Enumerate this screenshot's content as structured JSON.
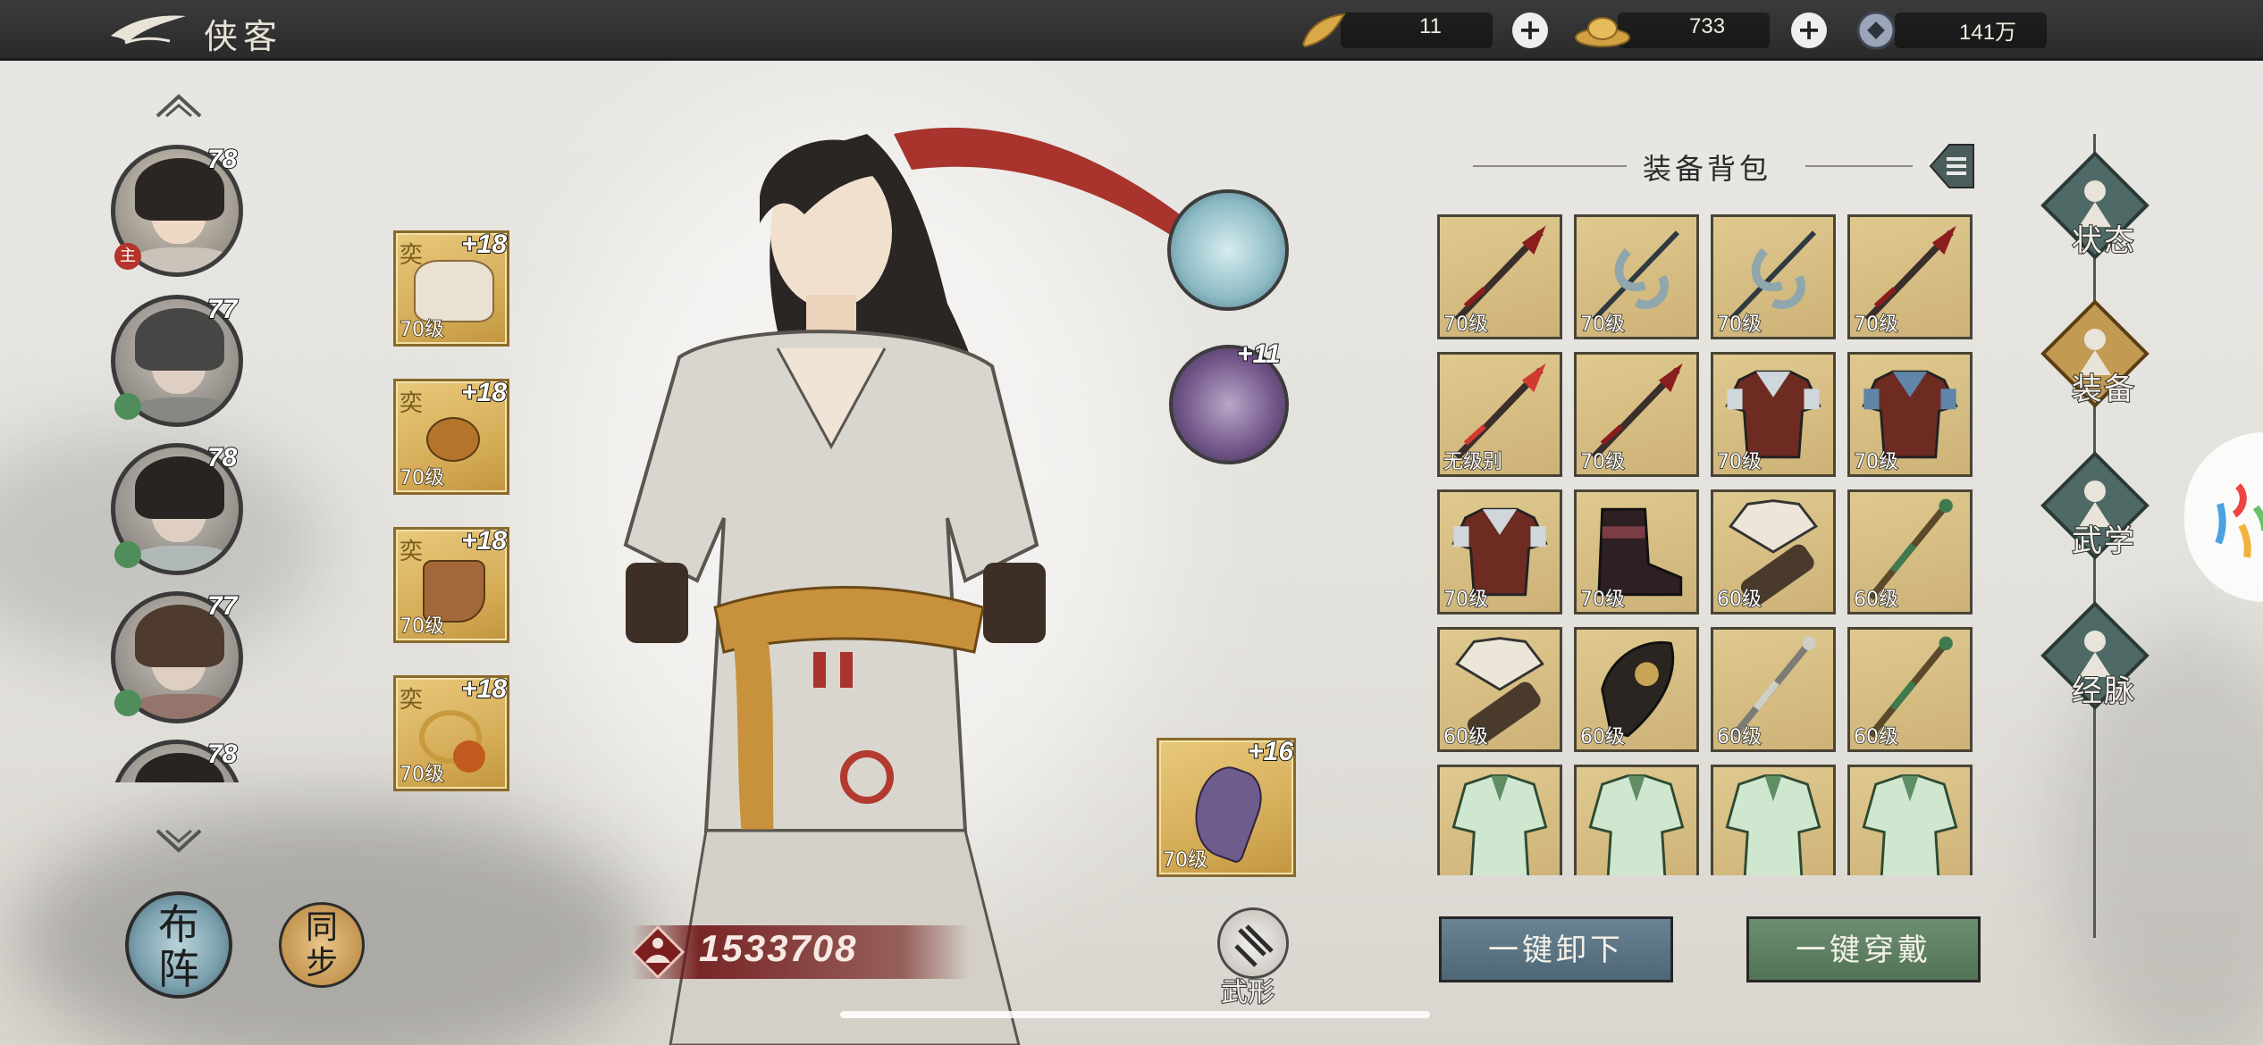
{
  "header": {
    "title": "侠客",
    "resources": [
      {
        "icon": "gold-ingot-icon",
        "value": "11"
      },
      {
        "icon": "gold-yuanbao-icon",
        "value": "733"
      },
      {
        "icon": "copper-coin-icon",
        "value": "141万"
      }
    ]
  },
  "roster": [
    {
      "level": "78",
      "badge": "主",
      "selected": true
    },
    {
      "level": "77",
      "badge": "",
      "selected": false
    },
    {
      "level": "78",
      "badge": "",
      "selected": false
    },
    {
      "level": "77",
      "badge": "",
      "selected": false
    },
    {
      "level": "78",
      "badge": "",
      "selected": false
    }
  ],
  "left_buttons": {
    "formation": "布阵",
    "sync": "同步"
  },
  "equipped": [
    {
      "plus": "+18",
      "level": "70级",
      "sigil": "奕",
      "kind": "robe"
    },
    {
      "plus": "+18",
      "level": "70级",
      "sigil": "奕",
      "kind": "belt"
    },
    {
      "plus": "+18",
      "level": "70级",
      "sigil": "奕",
      "kind": "boots"
    },
    {
      "plus": "+18",
      "level": "70级",
      "sigil": "奕",
      "kind": "ring"
    }
  ],
  "skill_orbs": [
    {
      "plus": "",
      "icon": "cloud-orb-icon"
    },
    {
      "plus": "+11",
      "icon": "purple-orb-icon"
    }
  ],
  "weapon_slot": {
    "plus": "+16",
    "level": "70级"
  },
  "power": {
    "value": "1533708"
  },
  "wuxing": {
    "label": "武形"
  },
  "bag": {
    "title": "装备背包",
    "items": [
      {
        "kind": "spear",
        "level": "70级"
      },
      {
        "kind": "claw",
        "level": "70级"
      },
      {
        "kind": "claw",
        "level": "70级"
      },
      {
        "kind": "spear",
        "level": "70级"
      },
      {
        "kind": "blade-red",
        "level": "无级别"
      },
      {
        "kind": "spear",
        "level": "70级"
      },
      {
        "kind": "armor",
        "level": "70级"
      },
      {
        "kind": "armor-blue",
        "level": "70级"
      },
      {
        "kind": "armor",
        "level": "70级"
      },
      {
        "kind": "boots",
        "level": "70级"
      },
      {
        "kind": "fan",
        "level": "60级"
      },
      {
        "kind": "staff",
        "level": "60级"
      },
      {
        "kind": "fan",
        "level": "60级"
      },
      {
        "kind": "shield",
        "level": "60级"
      },
      {
        "kind": "staff-silver",
        "level": "60级"
      },
      {
        "kind": "staff",
        "level": "60级"
      },
      {
        "kind": "robe-green",
        "level": ""
      },
      {
        "kind": "robe-green",
        "level": ""
      },
      {
        "kind": "robe-green",
        "level": ""
      },
      {
        "kind": "robe-green",
        "level": ""
      }
    ]
  },
  "actions": {
    "unequip_all": "一键卸下",
    "equip_all": "一键穿戴"
  },
  "side_nav": [
    {
      "label": "状态",
      "active": false
    },
    {
      "label": "装备",
      "active": true
    },
    {
      "label": "武学",
      "active": false
    },
    {
      "label": "经脉",
      "active": false
    }
  ],
  "colors": {
    "topbar": "#2e2e2e",
    "slot_gold": "#d6ae5a",
    "unequip_btn": "#5b7383",
    "equip_btn": "#5d7e62",
    "nav_active": "#c29a52",
    "nav_inactive": "#4f6a66"
  }
}
